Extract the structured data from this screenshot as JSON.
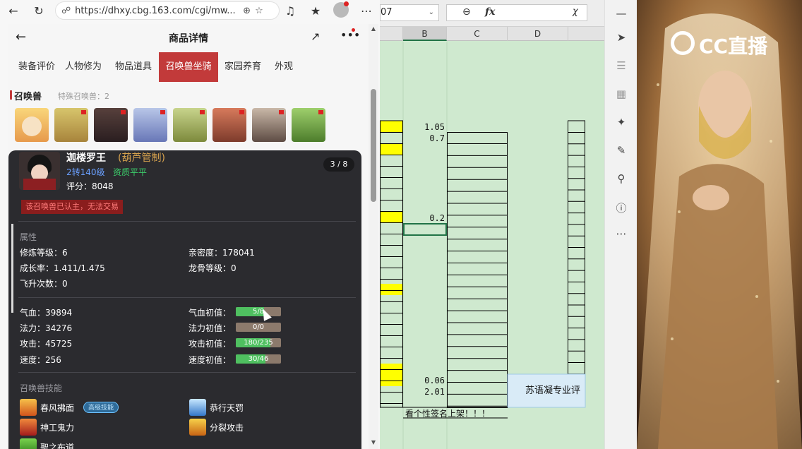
{
  "browser": {
    "url": "https://dhxy.cbg.163.com/cgi/mw...",
    "icons": [
      "back-icon",
      "refresh-icon",
      "lock-icon",
      "zoom-icon",
      "star-icon",
      "music-icon",
      "favorites-icon",
      "profile-icon",
      "more-icon"
    ]
  },
  "page": {
    "title": "商品详情",
    "tabs": [
      "装备评价",
      "人物修为",
      "物品道具",
      "召唤兽坐骑",
      "家园养育",
      "外观"
    ],
    "active_tab": "召唤兽坐骑",
    "pets_section": {
      "title": "召唤兽",
      "count_label": "特殊召唤兽：2"
    }
  },
  "pet": {
    "name": "迦楼罗王",
    "subname": "(葫芦管制)",
    "level": "2转140级",
    "quality": "资质平平",
    "score": "评分：8048",
    "page_indicator": "3 / 8",
    "warning": "该召唤兽已认主，无法交易",
    "attributes_label": "属性",
    "attributes": {
      "cultivation_level": "修炼等级：6",
      "intimacy": "亲密度：178041",
      "growth": "成长率：1.411/1.475",
      "dragon_bone": "龙骨等级：0",
      "ascension": "飞升次数：0"
    },
    "stats": {
      "hp": "气血：39894",
      "mp": "法力：34276",
      "attack": "攻击：45725",
      "speed": "速度：256",
      "hp_init_label": "气血初值：",
      "mp_init_label": "法力初值：",
      "attack_init_label": "攻击初值：",
      "speed_init_label": "速度初值：",
      "hp_init": {
        "text": "5/8",
        "fraction": 0.62
      },
      "mp_init": {
        "text": "0/0",
        "fraction": 0
      },
      "attack_init": {
        "text": "180/235",
        "fraction": 0.77
      },
      "speed_init": {
        "text": "30/46",
        "fraction": 0.65
      }
    },
    "skills_label": "召唤兽技能",
    "skills": [
      "春风拂面",
      "恭行天罚",
      "神工鬼力",
      "分裂攻击",
      "聖之布道"
    ],
    "skill_tag": "高级技能"
  },
  "sheet": {
    "name_box": "07",
    "fx_label": "fx",
    "columns": [
      "B",
      "C",
      "D"
    ],
    "values": {
      "b1": "1.05",
      "b2": "0.7",
      "b3": "0.2",
      "b4": "0.06",
      "b5": "2.01",
      "note": "看个性签名上架！！！",
      "d_text": "苏语凝专业评"
    }
  },
  "stream": {
    "brand": "CC直播"
  },
  "colors": {
    "accent_red": "#c23a3a",
    "sheet_green": "#cfe9cf",
    "cell_yellow": "#ffff00",
    "bar_green": "#4fc060"
  }
}
